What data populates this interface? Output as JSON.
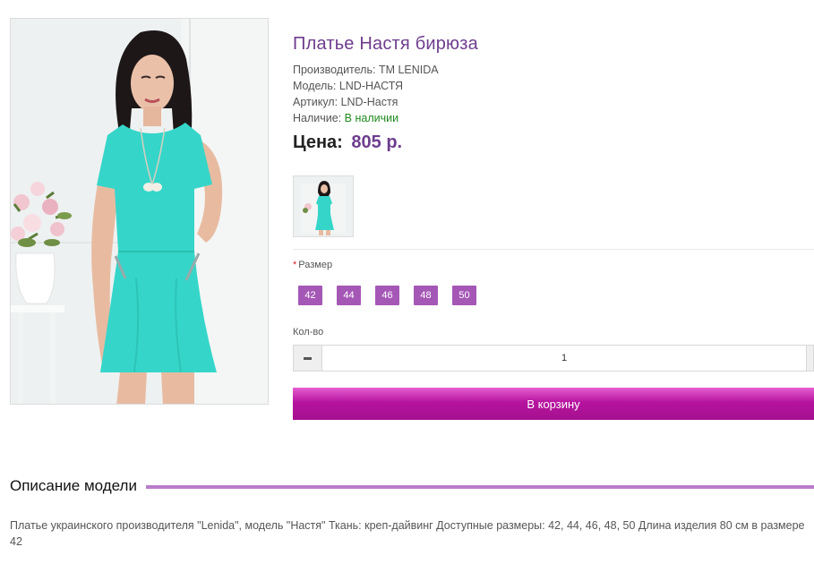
{
  "product": {
    "title": "Платье Настя бирюза",
    "manufacturer_label": "Производитель:",
    "manufacturer_value": "ТМ LENIDA",
    "model_label": "Модель:",
    "model_value": "LND-НАСТЯ",
    "sku_label": "Артикул:",
    "sku_value": "LND-Настя",
    "availability_label": "Наличие:",
    "availability_value": "В наличии",
    "price_label": "Цена:",
    "price_value": "805 р."
  },
  "options": {
    "required_mark": "*",
    "size_label": "Размер",
    "sizes": [
      "42",
      "44",
      "46",
      "48",
      "50"
    ],
    "quantity_label": "Кол-во",
    "quantity_value": "1"
  },
  "cart_button_label": "В корзину",
  "description": {
    "heading": "Описание модели",
    "text": "Платье украинского производителя \"Lenida\", модель \"Настя\" Ткань: креп-дайвинг Доступные размеры: 42, 44, 46, 48, 50 Длина изделия 80 см в размере 42"
  },
  "colors": {
    "title": "#6e3d8e",
    "size_button": "#a557b6",
    "cart_button": "#b6139f",
    "in_stock": "#1e8a1e",
    "divider": "#b97ccc",
    "dress": "#35d6c9"
  },
  "icons": {
    "minus": "minus-icon"
  }
}
